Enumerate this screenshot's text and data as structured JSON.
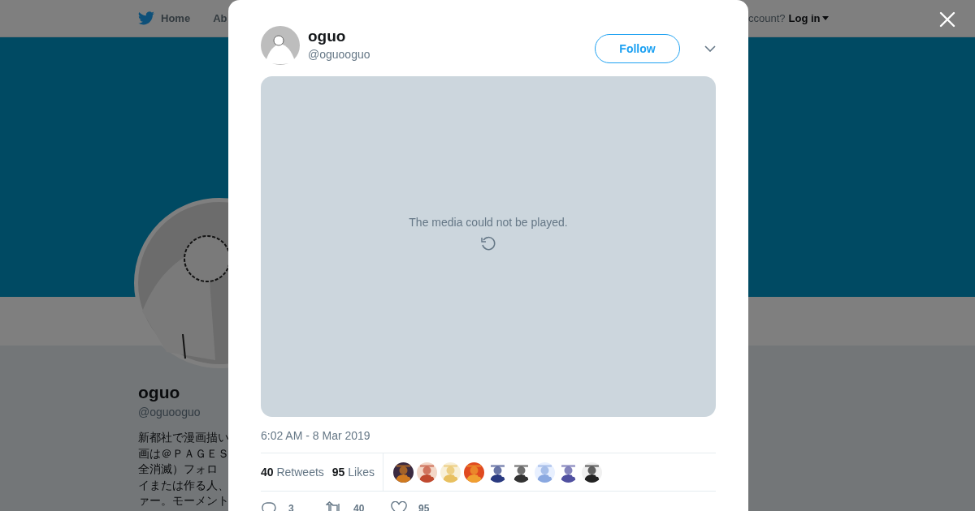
{
  "background_page": {
    "nav_items": [
      {
        "kind": "home",
        "label": "Home"
      },
      {
        "kind": "plain",
        "label": "Ab"
      }
    ],
    "login_prompt": "ccount?",
    "login_link": "Log in",
    "profile": {
      "name": "oguo",
      "handle": "@oguooguo",
      "bio_lines": [
        "新都社で漫画描い",
        "画は＠ＰＡＧＥＳ",
        "全消滅）フォロ",
        "イまたは作る人、",
        "ァー。モーメント"
      ]
    }
  },
  "tweet": {
    "author": {
      "name": "oguo",
      "handle": "@oguooguo"
    },
    "follow_button": "Follow",
    "media_message": "The media could not be played.",
    "timestamp": "6:02 AM - 8 Mar 2019",
    "stats": [
      {
        "count": "40",
        "label": "Retweets"
      },
      {
        "count": "95",
        "label": "Likes"
      }
    ],
    "actions": [
      {
        "kind": "reply",
        "count": "3"
      },
      {
        "kind": "retweet",
        "count": "40"
      },
      {
        "kind": "like",
        "count": "95"
      }
    ]
  }
}
